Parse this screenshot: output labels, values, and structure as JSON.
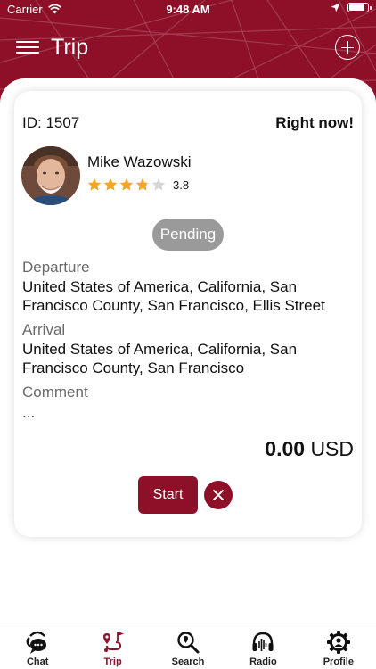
{
  "status_bar": {
    "carrier": "Carrier",
    "time": "9:48 AM",
    "battery_level": 0.92
  },
  "nav": {
    "title": "Trip"
  },
  "trip": {
    "id_label": "ID: 1507",
    "when": "Right now!",
    "status": "Pending",
    "driver": {
      "name": "Mike Wazowski",
      "rating": 3.8,
      "rating_text": "3.8"
    },
    "departure_label": "Departure",
    "departure": "United States of America, California, San Francisco County, San Francisco, Ellis Street",
    "arrival_label": "Arrival",
    "arrival": "United States of America, California, San Francisco County, San Francisco",
    "comment_label": "Comment",
    "comment": "...",
    "price_amount": "0.00",
    "currency": "USD",
    "start_label": "Start"
  },
  "tabs": [
    {
      "label": "Chat",
      "icon": "chat-icon",
      "active": false
    },
    {
      "label": "Trip",
      "icon": "route-icon",
      "active": true
    },
    {
      "label": "Search",
      "icon": "search-icon",
      "active": false
    },
    {
      "label": "Radio",
      "icon": "radio-icon",
      "active": false
    },
    {
      "label": "Profile",
      "icon": "profile-gear-icon",
      "active": false
    }
  ],
  "colors": {
    "brand": "#8e1028",
    "star": "#f5a623",
    "star_empty": "#d6d6d6",
    "pending": "#9a9a9a"
  }
}
